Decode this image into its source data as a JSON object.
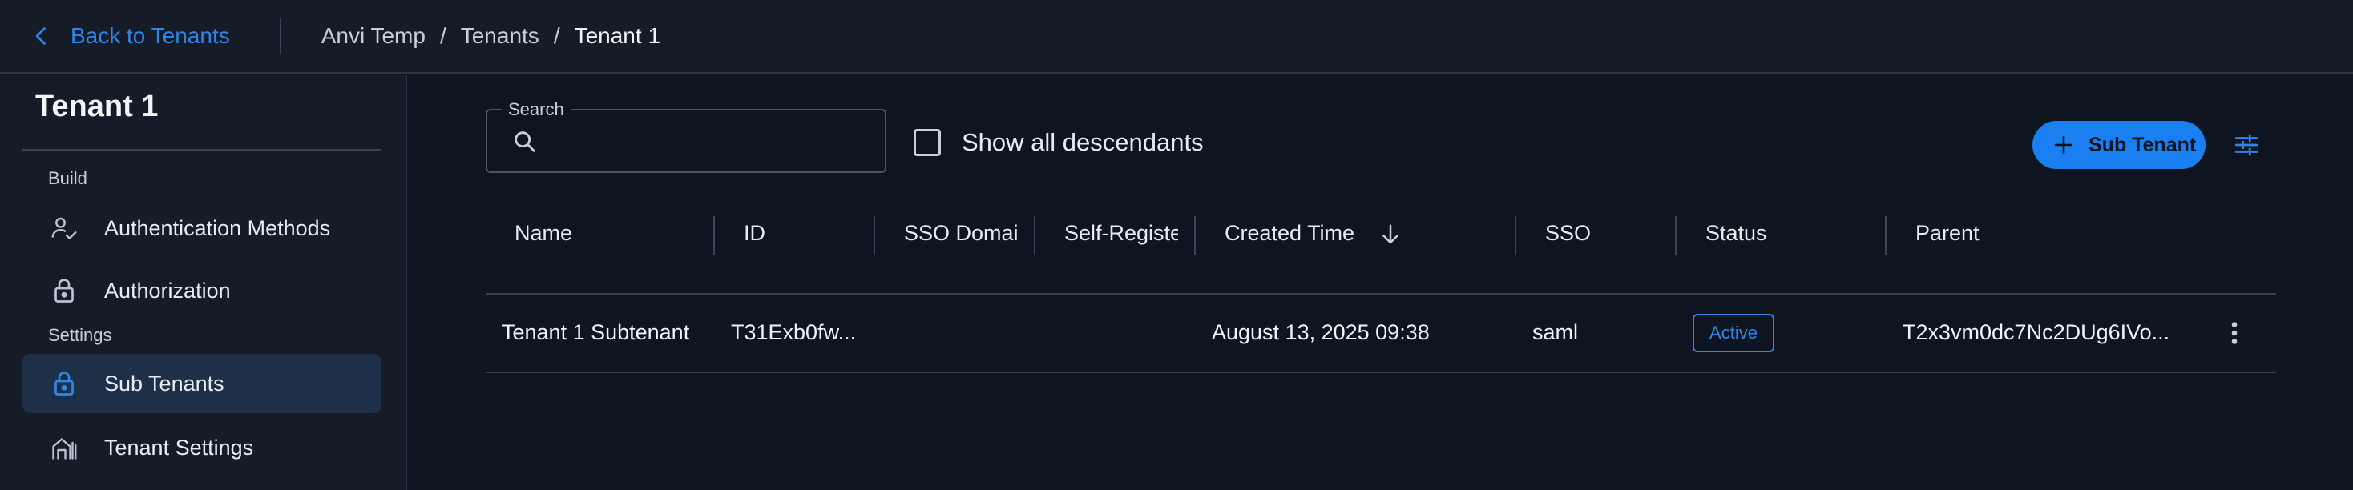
{
  "topbar": {
    "back_label": "Back to Tenants",
    "breadcrumb": [
      "Anvi Temp",
      "Tenants",
      "Tenant 1"
    ],
    "separator": "/"
  },
  "sidebar": {
    "title": "Tenant 1",
    "sections": {
      "build": "Build",
      "settings": "Settings"
    },
    "items": [
      {
        "label": "Authentication Methods",
        "icon": "user-check-icon"
      },
      {
        "label": "Authorization",
        "icon": "lock-icon"
      },
      {
        "label": "Sub Tenants",
        "icon": "lock-icon",
        "active": true
      },
      {
        "label": "Tenant Settings",
        "icon": "building-icon"
      }
    ]
  },
  "toolbar": {
    "search_label": "Search",
    "search_value": "",
    "show_descendants_label": "Show all descendants",
    "show_descendants_checked": false,
    "sub_tenant_button": "Sub Tenant"
  },
  "table": {
    "columns": [
      "Name",
      "ID",
      "SSO Domain",
      "Self-Registe",
      "Created Time",
      "SSO",
      "Status",
      "Parent"
    ],
    "sorted_column": "Created Time",
    "sort_direction": "descending",
    "rows": [
      {
        "name": "Tenant 1 Subtenant",
        "id": "T31Exb0fw...",
        "sso_domain": "",
        "self_registration": "",
        "created_time": "August 13, 2025 09:38",
        "sso": "saml",
        "status": "Active",
        "parent": "T2x3vm0dc7Nc2DUg6IVo..."
      }
    ]
  },
  "colors": {
    "accent": "#1a7ff0",
    "background": "#0f1520",
    "surface": "#151c27",
    "active_item": "#1d3048"
  }
}
